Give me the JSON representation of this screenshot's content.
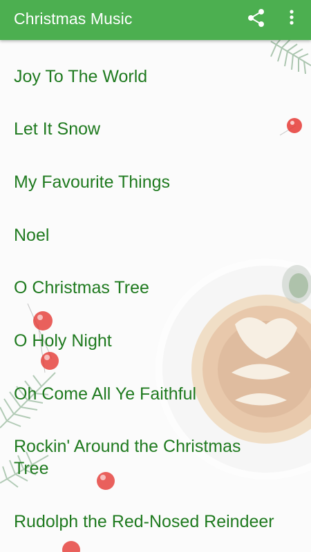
{
  "app_bar": {
    "title": "Christmas Music",
    "share_icon": "share-icon",
    "more_icon": "more-vert-icon",
    "color": "#4caf50"
  },
  "songs": [
    "Joy To The World",
    "Let It Snow",
    "My Favourite Things",
    "Noel",
    "O Christmas Tree",
    "O Holy Night",
    "Oh Come All Ye Faithful",
    "Rockin' Around the Christmas Tree",
    "Rudolph the Red-Nosed Reindeer"
  ],
  "colors": {
    "song_text": "#1f7a1f",
    "berry": "#e53935"
  }
}
